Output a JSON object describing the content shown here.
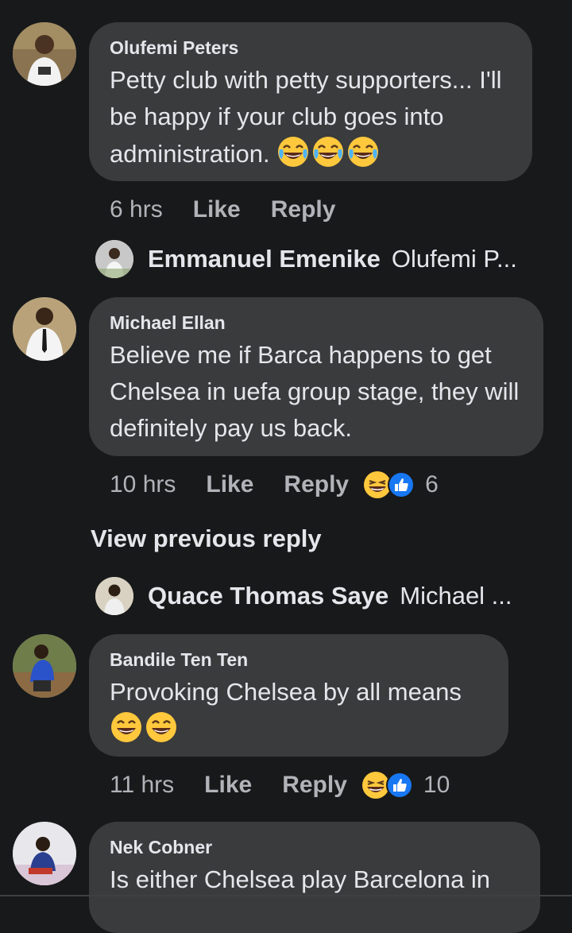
{
  "comments": [
    {
      "author": "Olufemi Peters",
      "text": "Petty club with petty supporters... I'll be happy if your club goes into administration.",
      "emojis": [
        "joy",
        "joy",
        "joy"
      ],
      "time": "6 hrs",
      "like_label": "Like",
      "reply_label": "Reply",
      "reply_preview": {
        "name": "Emmanuel Emenike",
        "snippet": "Olufemi P..."
      }
    },
    {
      "author": "Michael Ellan",
      "text": "Believe me if Barca happens to get Chelsea in uefa group stage, they will definitely pay us back.",
      "time": "10 hrs",
      "like_label": "Like",
      "reply_label": "Reply",
      "reaction_count": "6",
      "view_previous": "View previous reply",
      "reply_preview": {
        "name": "Quace Thomas Saye",
        "snippet": "Michael ..."
      }
    },
    {
      "author": "Bandile Ten Ten",
      "text": "Provoking Chelsea by all means",
      "emojis": [
        "grin",
        "grin"
      ],
      "time": "11 hrs",
      "like_label": "Like",
      "reply_label": "Reply",
      "reaction_count": "10"
    },
    {
      "author": "Nek Cobner",
      "text": "Is either Chelsea play Barcelona in"
    }
  ],
  "colors": {
    "background": "#18191a",
    "bubble": "#3a3b3c",
    "primary_text": "#e4e6eb",
    "secondary_text": "#b0b3b8",
    "like_blue": "#1877f2",
    "emoji_yellow": "#ffc83d"
  },
  "icons": [
    "joy-emoji-icon",
    "grin-emoji-icon",
    "haha-reaction-icon",
    "like-reaction-icon"
  ]
}
